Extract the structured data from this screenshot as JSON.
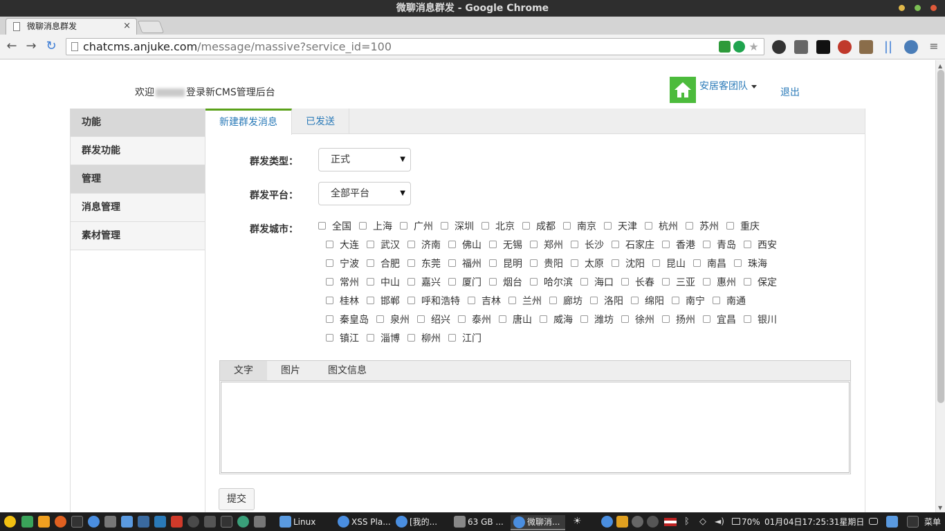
{
  "window": {
    "title": "微聊消息群发 - Google Chrome",
    "tab_title": "微聊消息群发",
    "tab_close": "×"
  },
  "toolbar": {
    "back": "←",
    "forward": "→",
    "reload": "↻",
    "url_host": "chatcms.anjuke.com",
    "url_path": "/message/massive?service_id=100",
    "menu": "≡"
  },
  "header": {
    "welcome_prefix": "欢迎",
    "welcome_suffix": "登录新CMS管理后台",
    "team_label": "安居客团队",
    "logout_label": "退出"
  },
  "sidebar": {
    "items": [
      {
        "label": "功能",
        "type": "header"
      },
      {
        "label": "群发功能",
        "type": "item"
      },
      {
        "label": "管理",
        "type": "header"
      },
      {
        "label": "消息管理",
        "type": "item"
      },
      {
        "label": "素材管理",
        "type": "item"
      }
    ]
  },
  "main": {
    "tabs": [
      {
        "label": "新建群发消息",
        "active": true
      },
      {
        "label": "已发送",
        "active": false
      }
    ],
    "form": {
      "type_label": "群发类型：",
      "type_value": "正式",
      "platform_label": "群发平台：",
      "platform_value": "全部平台",
      "city_label": "群发城市："
    },
    "city_rows": [
      [
        "全国",
        "上海",
        "广州",
        "深圳",
        "北京",
        "成都",
        "南京",
        "天津",
        "杭州",
        "苏州",
        "重庆"
      ],
      [
        "大连",
        "武汉",
        "济南",
        "佛山",
        "无锡",
        "郑州",
        "长沙",
        "石家庄",
        "香港",
        "青岛",
        "西安"
      ],
      [
        "宁波",
        "合肥",
        "东莞",
        "福州",
        "昆明",
        "贵阳",
        "太原",
        "沈阳",
        "昆山",
        "南昌",
        "珠海"
      ],
      [
        "常州",
        "中山",
        "嘉兴",
        "厦门",
        "烟台",
        "哈尔滨",
        "海口",
        "长春",
        "三亚",
        "惠州",
        "保定"
      ],
      [
        "桂林",
        "邯郸",
        "呼和浩特",
        "吉林",
        "兰州",
        "廊坊",
        "洛阳",
        "绵阳",
        "南宁",
        "南通"
      ],
      [
        "秦皇岛",
        "泉州",
        "绍兴",
        "泰州",
        "唐山",
        "威海",
        "潍坊",
        "徐州",
        "扬州",
        "宜昌",
        "银川"
      ],
      [
        "镇江",
        "淄博",
        "柳州",
        "江门"
      ]
    ],
    "editor_tabs": [
      "文字",
      "图片",
      "图文信息"
    ],
    "submit_label": "提交"
  },
  "taskbar": {
    "items": [
      {
        "label": "Linux"
      },
      {
        "label": "XSS Pla..."
      },
      {
        "label": "[我的..."
      },
      {
        "label": "63 GB ..."
      },
      {
        "label": "微聊消..."
      }
    ],
    "battery": "70%",
    "datetime": "01月04日17:25:31星期日",
    "menu_label": "菜单"
  },
  "colors": {
    "accent_green": "#5aa11a",
    "home_icon_green": "#4cbb3c",
    "link_blue": "#2a7ab8"
  }
}
